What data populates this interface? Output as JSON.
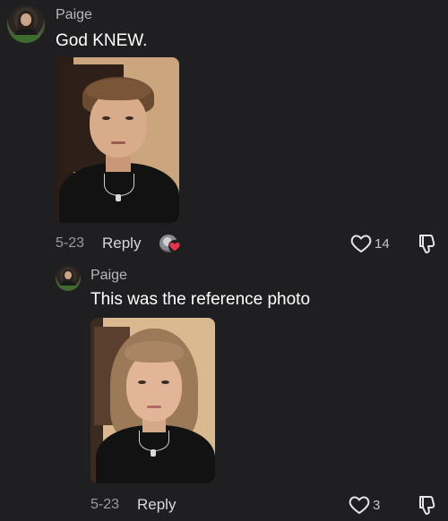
{
  "comments": [
    {
      "username": "Paige",
      "text": "God KNEW.",
      "date": "5-23",
      "reply_label": "Reply",
      "like_count": "14"
    },
    {
      "username": "Paige",
      "text": "This was the reference photo",
      "date": "5-23",
      "reply_label": "Reply",
      "like_count": "3"
    }
  ],
  "colors": {
    "background": "#1f1f21",
    "heart_reaction": "#e8344a"
  },
  "icons": {
    "like": "heart-outline-icon",
    "dislike": "thumbs-down-icon",
    "reaction": "heart-reaction-icon"
  }
}
